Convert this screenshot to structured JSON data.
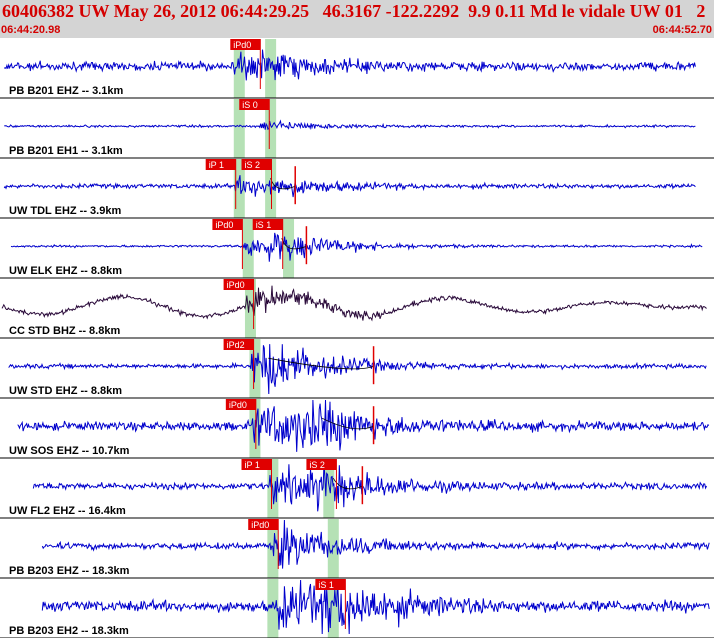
{
  "header": {
    "title": "60406382 UW May 26, 2012 06:44:29.25   46.3167 -122.2292  9.9 0.11 Md le vidale UW 01   2",
    "start_time": "06:44:20.98",
    "end_time": "06:44:52.70"
  },
  "colors": {
    "header_bg": "#d4d4d4",
    "header_text": "#d40000",
    "trace_blue": "#0000cc",
    "trace_dark": "#2a0a3a",
    "pick_red": "#e00000",
    "window_green": "#a8dca8",
    "separator": "#000000"
  },
  "chart_data": {
    "type": "seismogram",
    "time_axis": {
      "start": "06:44:20.98",
      "end": "06:44:52.70"
    },
    "traces": [
      {
        "label": "PB B201 EHZ -- 3.1km",
        "color": "blue",
        "amplitude": 7,
        "noise": 4,
        "start_time": 0.1,
        "end_time": 31.0,
        "onset": 10.3,
        "peak": 11.8,
        "picks": [
          {
            "label": "iPd0",
            "time": 10.2
          }
        ],
        "windows": [
          10.4,
          11.8
        ]
      },
      {
        "label": "PB B201 EH1 -- 3.1km",
        "color": "blue",
        "amplitude": 3,
        "noise": 1,
        "start_time": 0.1,
        "end_time": 31.0,
        "onset": 11.5,
        "peak": 11.9,
        "picks": [
          {
            "label": "iS 0",
            "time": 10.6
          }
        ],
        "windows": [
          10.4,
          11.8
        ]
      },
      {
        "label": "UW TDL EHZ -- 3.9km",
        "color": "blue",
        "amplitude": 6,
        "noise": 2,
        "start_time": 0.1,
        "end_time": 31.0,
        "onset": 10.4,
        "peak": 12.0,
        "picks": [
          {
            "label": "iP 1",
            "time": 9.1
          },
          {
            "label": "iS 2",
            "time": 10.7
          }
        ],
        "windows": [
          10.4,
          11.8
        ],
        "coda": 13.1
      },
      {
        "label": "UW ELK EHZ -- 8.8km",
        "color": "blue",
        "amplitude": 9,
        "noise": 1,
        "start_time": 0.4,
        "end_time": 31.3,
        "onset": 10.8,
        "peak": 12.5,
        "picks": [
          {
            "label": "iPd0",
            "time": 9.4
          },
          {
            "label": "iS 1",
            "time": 11.2
          }
        ],
        "windows": [
          10.8,
          12.6
        ],
        "coda": 13.6
      },
      {
        "label": "CC STD BHZ -- 8.8km",
        "color": "dark",
        "amplitude": 8,
        "noise": 2,
        "start_time": 0.0,
        "end_time": 31.5,
        "onset": 10.9,
        "peak": 11.3,
        "picks": [
          {
            "label": "iPd0",
            "time": 9.9
          }
        ],
        "windows": [
          10.9
        ],
        "long_period": 10
      },
      {
        "label": "UW STD EHZ -- 8.8km",
        "color": "blue",
        "amplitude": 16,
        "noise": 2,
        "start_time": 0.3,
        "end_time": 31.5,
        "onset": 11.1,
        "peak": 11.9,
        "picks": [
          {
            "label": "iPd2",
            "time": 9.9
          }
        ],
        "windows": [
          11.1
        ],
        "coda": 16.6
      },
      {
        "label": "UW SOS EHZ -- 10.7km",
        "color": "blue",
        "amplitude": 14,
        "noise": 4,
        "start_time": 0.7,
        "end_time": 31.6,
        "onset": 11.1,
        "peak": 14.3,
        "picks": [
          {
            "label": "iPd0",
            "time": 10.0
          }
        ],
        "windows": [
          11.1
        ],
        "coda": 16.6
      },
      {
        "label": "UW FL2 EHZ -- 16.4km",
        "color": "blue",
        "amplitude": 11,
        "noise": 3,
        "start_time": 1.4,
        "end_time": 31.5,
        "onset": 11.9,
        "peak": 14.8,
        "picks": [
          {
            "label": "iP 1",
            "time": 10.7
          },
          {
            "label": "iS 2",
            "time": 13.6
          }
        ],
        "windows": [
          11.9,
          14.4
        ],
        "coda": 16.1
      },
      {
        "label": "PB B203 EHZ -- 18.3km",
        "color": "blue",
        "amplitude": 13,
        "noise": 3,
        "start_time": 1.8,
        "end_time": 31.6,
        "onset": 12.1,
        "peak": 12.4,
        "picks": [
          {
            "label": "iPd0",
            "time": 11.0
          }
        ],
        "windows": [
          11.9,
          14.6
        ]
      },
      {
        "label": "PB B203 EH2 -- 18.3km",
        "color": "blue",
        "amplitude": 15,
        "noise": 5,
        "start_time": 1.8,
        "end_time": 31.6,
        "onset": 12.2,
        "peak": 15.4,
        "picks": [
          {
            "label": "iS 1",
            "time": 14.0
          }
        ],
        "windows": [
          11.9,
          14.6
        ]
      }
    ]
  }
}
